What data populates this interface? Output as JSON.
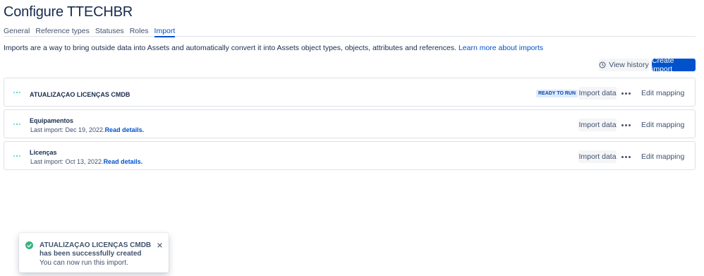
{
  "page": {
    "title": "Configure TTECHBR"
  },
  "tabs": [
    {
      "label": "General"
    },
    {
      "label": "Reference types"
    },
    {
      "label": "Statuses"
    },
    {
      "label": "Roles"
    },
    {
      "label": "Import",
      "active": true
    }
  ],
  "intro": {
    "text": "Imports are a way to bring outside data into Assets and automatically convert it into Assets object types, objects, attributes and references.",
    "link_label": "Learn more about imports"
  },
  "toolbar": {
    "view_history_label": "View history",
    "view_history_icon": "clock-icon",
    "create_import_label": "Create import"
  },
  "imports": [
    {
      "name": "ATUALIZAÇAO LICENÇAS CMDB",
      "status": "READY TO RUN",
      "import_label": "Import data",
      "edit_label": "Edit mapping"
    },
    {
      "name": "Equipamentos",
      "last_import": "Last import: Dec 19, 2022.",
      "read_details": "Read details.",
      "import_label": "Import data",
      "edit_label": "Edit mapping"
    },
    {
      "name": "Licenças",
      "last_import": "Last import: Oct 13, 2022.",
      "read_details": "Read details.",
      "import_label": "Import data",
      "edit_label": "Edit mapping"
    }
  ],
  "flag": {
    "title": "ATUALIZAÇAO LICENÇAS CMDB has been successfully created",
    "body": "You can now run this import.",
    "icon": "check-circle-icon",
    "close_icon": "close-icon"
  },
  "colors": {
    "primary": "#0052cc",
    "success": "#36b37e",
    "lozenge_bg": "#deebff",
    "lozenge_text": "#0747a6",
    "text": "#172b4d",
    "subtle_text": "#42526e"
  }
}
